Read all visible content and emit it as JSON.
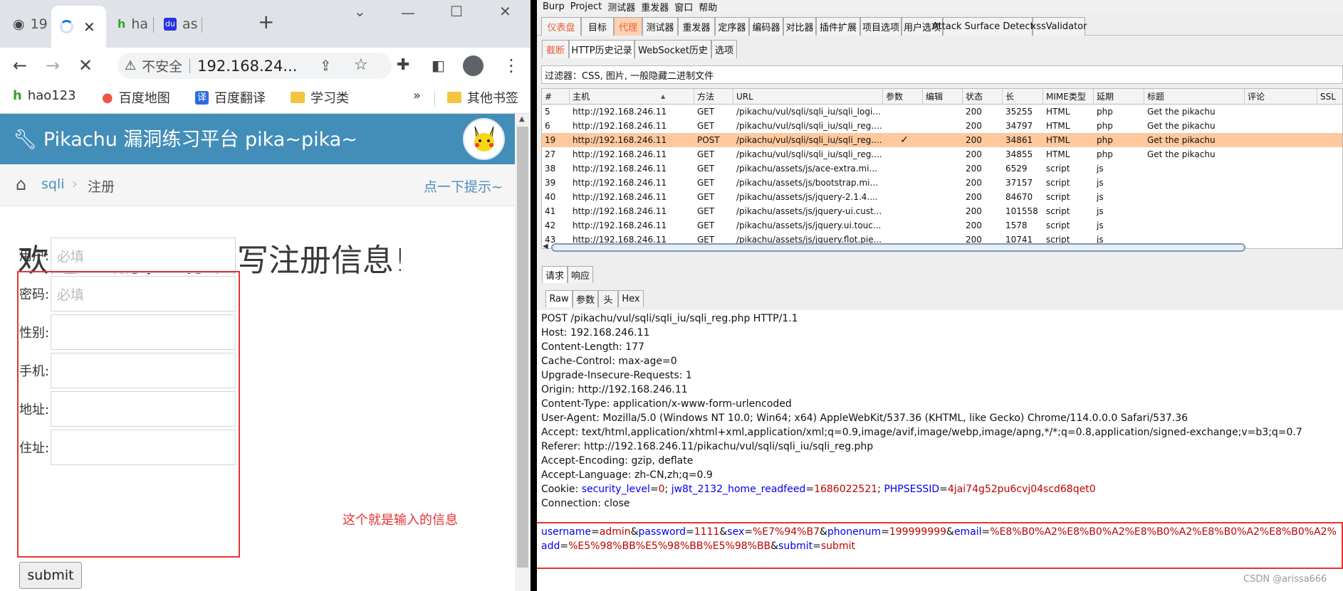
{
  "browser": {
    "tabs": [
      {
        "title": "19",
        "icon": "globe-icon"
      },
      {
        "title": "",
        "icon": "loading-icon",
        "close": "✕"
      },
      {
        "title": "ha",
        "icon": "hao123-icon"
      },
      {
        "title": "as",
        "icon": "baidu-icon"
      }
    ],
    "new_tab": "+",
    "insecure_label": "不安全",
    "url": "192.168.24...",
    "bookmarks": [
      {
        "label": "hao123"
      },
      {
        "label": "百度地图"
      },
      {
        "label": "百度翻译"
      },
      {
        "label": "学习类"
      }
    ],
    "bookmarks_more": "»",
    "other_bookmarks": "其他书签"
  },
  "page": {
    "title": "Pikachu 漏洞练习平台 pika~pika~",
    "breadcrumb": {
      "section": "sqli",
      "current": "注册"
    },
    "hint_link": "点一下提示~",
    "heading": "欢迎注册，请填写注册信息!",
    "fields": [
      {
        "label": "用户:",
        "placeholder": "必填"
      },
      {
        "label": "密码:",
        "placeholder": "必填"
      },
      {
        "label": "性别:",
        "placeholder": ""
      },
      {
        "label": "手机:",
        "placeholder": ""
      },
      {
        "label": "地址:",
        "placeholder": ""
      },
      {
        "label": "住址:",
        "placeholder": ""
      }
    ],
    "note": "这个就是输入的信息",
    "submit": "submit"
  },
  "burp": {
    "menu": [
      "Burp",
      "Project",
      "测试器",
      "重发器",
      "窗口",
      "帮助"
    ],
    "main_tabs": [
      "仪表盘",
      "目标",
      "代理",
      "测试器",
      "重发器",
      "定序器",
      "编码器",
      "对比器",
      "插件扩展",
      "项目选项",
      "用户选项",
      "Attack Surface Detector",
      "xssValidator"
    ],
    "sub_tabs": [
      "截断",
      "HTTP历史记录",
      "WebSocket历史",
      "选项"
    ],
    "filter": "过滤器：CSS, 图片, 一般隐藏二进制文件",
    "columns": [
      "#",
      "主机",
      "方法",
      "URL",
      "参数",
      "编辑",
      "状态",
      "长",
      "MIME类型",
      "延期",
      "标题",
      "评论",
      "SSL"
    ],
    "rows": [
      {
        "id": "5",
        "host": "http://192.168.246.11",
        "method": "GET",
        "url": "/pikachu/vul/sqli/sqli_iu/sqli_logi...",
        "params": "",
        "status": "200",
        "length": "35255",
        "mime": "HTML",
        "ext": "php",
        "title": "Get the pikachu"
      },
      {
        "id": "6",
        "host": "http://192.168.246.11",
        "method": "GET",
        "url": "/pikachu/vul/sqli/sqli_iu/sqli_reg....",
        "params": "",
        "status": "200",
        "length": "34797",
        "mime": "HTML",
        "ext": "php",
        "title": "Get the pikachu"
      },
      {
        "id": "19",
        "host": "http://192.168.246.11",
        "method": "POST",
        "url": "/pikachu/vul/sqli/sqli_iu/sqli_reg....",
        "params": "✓",
        "status": "200",
        "length": "34861",
        "mime": "HTML",
        "ext": "php",
        "title": "Get the pikachu"
      },
      {
        "id": "27",
        "host": "http://192.168.246.11",
        "method": "GET",
        "url": "/pikachu/vul/sqli/sqli_iu/sqli_reg....",
        "params": "",
        "status": "200",
        "length": "34855",
        "mime": "HTML",
        "ext": "php",
        "title": "Get the pikachu"
      },
      {
        "id": "38",
        "host": "http://192.168.246.11",
        "method": "GET",
        "url": "/pikachu/assets/js/ace-extra.mi...",
        "params": "",
        "status": "200",
        "length": "6529",
        "mime": "script",
        "ext": "js",
        "title": ""
      },
      {
        "id": "39",
        "host": "http://192.168.246.11",
        "method": "GET",
        "url": "/pikachu/assets/js/bootstrap.mi...",
        "params": "",
        "status": "200",
        "length": "37157",
        "mime": "script",
        "ext": "js",
        "title": ""
      },
      {
        "id": "40",
        "host": "http://192.168.246.11",
        "method": "GET",
        "url": "/pikachu/assets/js/jquery-2.1.4....",
        "params": "",
        "status": "200",
        "length": "84670",
        "mime": "script",
        "ext": "js",
        "title": ""
      },
      {
        "id": "41",
        "host": "http://192.168.246.11",
        "method": "GET",
        "url": "/pikachu/assets/js/jquery-ui.cust...",
        "params": "",
        "status": "200",
        "length": "101558",
        "mime": "script",
        "ext": "js",
        "title": ""
      },
      {
        "id": "42",
        "host": "http://192.168.246.11",
        "method": "GET",
        "url": "/pikachu/assets/js/jquery.ui.touc...",
        "params": "",
        "status": "200",
        "length": "1578",
        "mime": "script",
        "ext": "js",
        "title": ""
      },
      {
        "id": "43",
        "host": "http://192.168.246.11",
        "method": "GET",
        "url": "/pikachu/assets/js/jquery.flot.pie...",
        "params": "",
        "status": "200",
        "length": "10741",
        "mime": "script",
        "ext": "js",
        "title": ""
      }
    ],
    "selected_row": "19",
    "req_tabs": [
      "请求",
      "响应"
    ],
    "view_tabs": [
      "Raw",
      "参数",
      "头",
      "Hex"
    ],
    "request_lines": [
      "POST /pikachu/vul/sqli/sqli_iu/sqli_reg.php HTTP/1.1",
      "Host: 192.168.246.11",
      "Content-Length: 177",
      "Cache-Control: max-age=0",
      "Upgrade-Insecure-Requests: 1",
      "Origin: http://192.168.246.11",
      "Content-Type: application/x-www-form-urlencoded",
      "User-Agent: Mozilla/5.0 (Windows NT 10.0; Win64; x64) AppleWebKit/537.36 (KHTML, like Gecko) Chrome/114.0.0.0 Safari/537.36",
      "Accept: text/html,application/xhtml+xml,application/xml;q=0.9,image/avif,image/webp,image/apng,*/*;q=0.8,application/signed-exchange;v=b3;q=0.7",
      "Referer: http://192.168.246.11/pikachu/vul/sqli/sqli_iu/sqli_reg.php",
      "Accept-Encoding: gzip, deflate",
      "Accept-Language: zh-CN,zh;q=0.9"
    ],
    "cookie": {
      "label": "Cookie: ",
      "pairs": [
        {
          "k": "security_level",
          "v": "0"
        },
        {
          "k": "jw8t_2132_home_readfeed",
          "v": "1686022521"
        },
        {
          "k": "PHPSESSID",
          "v": "4jai74g52pu6cvj04scd68qet0"
        }
      ]
    },
    "connection": "Connection: close",
    "body_line1": [
      {
        "k": "username",
        "v": "admin"
      },
      {
        "k": "password",
        "v": "1111"
      },
      {
        "k": "sex",
        "v": "%E7%94%B7"
      },
      {
        "k": "phonenum",
        "v": "199999999"
      },
      {
        "k": "email",
        "v": "%E8%B0%A2%E8%B0%A2%E8%B0%A2%E8%B0%A2%E8%B0%A2%"
      }
    ],
    "body_line2": [
      {
        "k": "add",
        "v": "%E5%98%BB%E5%98%BB%E5%98%BB"
      },
      {
        "k": "submit",
        "v": "submit"
      }
    ],
    "colors": {
      "key": "#0000ee",
      "value": "#c00000",
      "selected_row": "#ffc89d",
      "highlight_tab": "#e8643a"
    }
  },
  "watermark": "CSDN @arissa666"
}
